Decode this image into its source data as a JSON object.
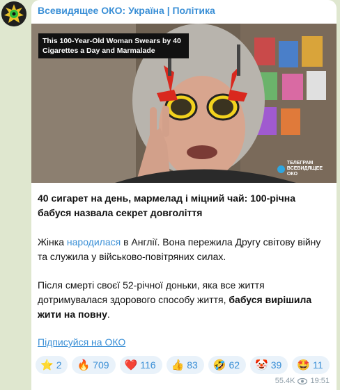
{
  "channel": {
    "name": "Всевидящее ОКО: Україна | Політика"
  },
  "photo": {
    "overlay_title": "This 100-Year-Old Woman Swears by 40 Cigarettes a Day and Marmalade",
    "watermark_line1": "ТЕЛЕГРАМ",
    "watermark_line2": "ВСЕВИДЯЩЕЕ",
    "watermark_line3": "ОКО"
  },
  "message": {
    "headline": "40 сигарет на день, мармелад і міцний чай: 100-річна бабуся назвала секрет довголіття",
    "p1_before": "Жінка ",
    "p1_link": "народилася",
    "p1_after": " в Англії. Вона пережила Другу світову війну та служила у військово-повітряних силах.",
    "p2_before": "Після смерті своєї 52-річної доньки, яка все життя дотримувалася здорового способу життя, ",
    "p2_bold": "бабуся вирішила жити на повну",
    "p2_after": ".",
    "subscribe": "Підписуйся на ОКО"
  },
  "reactions": [
    {
      "icon": "⭐",
      "icon_name": "star-icon",
      "count": "2"
    },
    {
      "icon": "🔥",
      "icon_name": "fire-icon",
      "count": "709"
    },
    {
      "icon": "❤️",
      "icon_name": "heart-icon",
      "count": "116"
    },
    {
      "icon": "👍",
      "icon_name": "thumbs-up-icon",
      "count": "83"
    },
    {
      "icon": "🤣",
      "icon_name": "rofl-icon",
      "count": "62"
    },
    {
      "icon": "🤡",
      "icon_name": "clown-icon",
      "count": "39"
    },
    {
      "icon": "🤩",
      "icon_name": "star-struck-icon",
      "count": "11"
    }
  ],
  "meta": {
    "views": "55.4K",
    "time": "19:51"
  },
  "colors": {
    "accent": "#3a8fd6",
    "chip_bg": "#e9f2fa",
    "chat_bg": "#dfe7cf"
  }
}
